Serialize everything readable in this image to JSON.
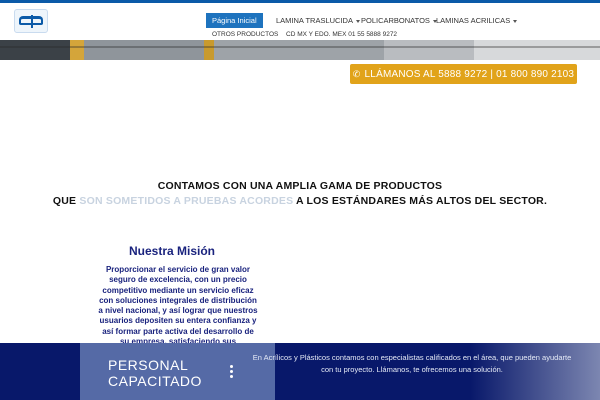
{
  "nav": {
    "items": [
      {
        "label": "Página Inicial",
        "active": true
      },
      {
        "label": "LAMINA TRASLUCIDA",
        "dropdown": true
      },
      {
        "label": "POLICARBONATOS",
        "dropdown": true
      },
      {
        "label": "LAMINAS ACRILICAS",
        "dropdown": true
      }
    ],
    "row2": [
      "OTROS PRODUCTOS",
      "CD MX Y EDO. MEX 01 55 5888 9272"
    ]
  },
  "call_button": {
    "label": "LLÁMANOS AL 5888 9272 | 01 800 890 2103",
    "icon": "phone-icon",
    "color": "#e1a31a"
  },
  "headline": {
    "line1": "CONTAMOS CON UNA AMPLIA GAMA DE PRODUCTOS",
    "line2_start": "QUE",
    "line2_faded": "SON SOMETIDOS A PRUEBAS ACORDES",
    "line2_end": "A LOS ESTÁNDARES MÁS ALTOS DEL SECTOR."
  },
  "mission": {
    "title": "Nuestra Misión",
    "text": "Proporcionar el servicio de gran valor seguro de excelencia, con un precio competitivo mediante un servicio eficaz con soluciones integrales de distribución a nivel nacional, y así lograr que nuestros usuarios depositen su entera confianza y así formar parte activa del desarrollo de su empresa, satisfaciendo sus requerimientos con un alto grado de calidad."
  },
  "bottom": {
    "card_title": "PERSONAL CAPACITADO",
    "text": "En Acrílicos y Plásticos contamos con especialistas calificados en el área, que pueden ayudarte con tu proyecto. Llámanos, te ofrecemos una solución.",
    "band_color": "#08186a"
  },
  "colors": {
    "brand_blue": "#1e73be",
    "mission_blue": "#1a237e"
  }
}
